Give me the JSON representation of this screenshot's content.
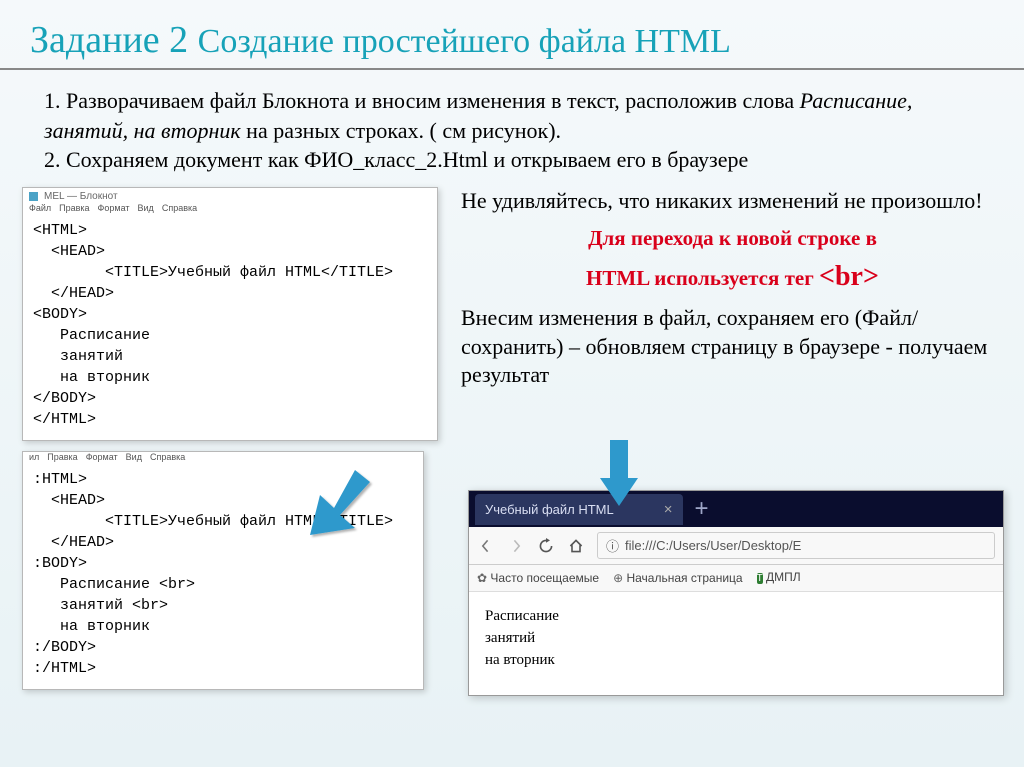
{
  "title": {
    "main": "Задание 2 ",
    "sub": "Создание простейшего файла HTML"
  },
  "instructions": {
    "line1a": "1. Разворачиваем файл Блокнота и вносим изменения в текст, расположив слова ",
    "line1b_italic": "Расписание, занятий, на вторник",
    "line1c": " на разных строках. ( см рисунок).",
    "line2": "2. Сохраняем документ как ФИО_класс_2.Html и открываем его в браузере"
  },
  "notepad1": {
    "title": "MEL — Блокнот",
    "menu": [
      "Файл",
      "Правка",
      "Формат",
      "Вид",
      "Справка"
    ],
    "text": "<HTML>\n  <HEAD>\n        <TITLE>Учебный файл HTML</TITLE>\n  </HEAD>\n<BODY>\n   Расписание\n   занятий\n   на вторник\n</BODY>\n</HTML>"
  },
  "notepad2": {
    "menu": [
      "ил",
      "Правка",
      "Формат",
      "Вид",
      "Справка"
    ],
    "text": ":HTML>\n  <HEAD>\n        <TITLE>Учебный файл HTML</TITLE>\n  </HEAD>\n:BODY>\n   Расписание <br>\n   занятий <br>\n   на вторник\n:/BODY>\n:/HTML>"
  },
  "right": {
    "p1": "Не удивляйтесь, что никаких изменений не произошло!",
    "red1": "Для перехода к новой строке в",
    "red2a": "HTML используется тег ",
    "red2b": "<br>",
    "p2": "Внесим изменения в файл, сохраняем его (Файл/сохранить) – обновляем страницу в браузере - получаем результат"
  },
  "browser": {
    "tab_title": "Учебный файл HTML",
    "url_prefix": "ⓘ",
    "url": "file:///C:/Users/User/Desktop/E",
    "bookmarks": {
      "b1": "Часто посещаемые",
      "b2": "Начальная страница",
      "b3": "ДМПЛ"
    },
    "content1": "Расписание",
    "content2": "занятий",
    "content3": "на вторник"
  }
}
